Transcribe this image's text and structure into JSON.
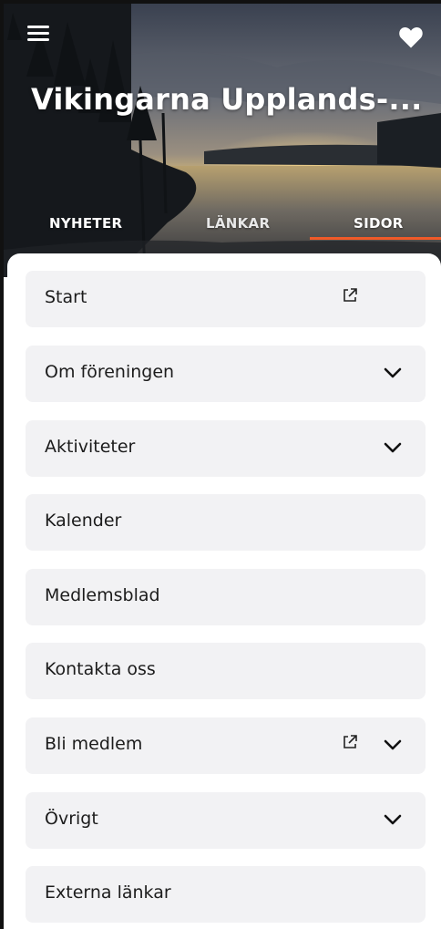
{
  "header": {
    "title": "Vikingarna Upplands-...",
    "menu_icon": "hamburger-menu-icon",
    "favorite_icon": "heart-icon"
  },
  "tabs": [
    {
      "label": "NYHETER",
      "active": false
    },
    {
      "label": "LÄNKAR",
      "active": false
    },
    {
      "label": "SIDOR",
      "active": true
    }
  ],
  "colors": {
    "accent": "#f05a28",
    "item_background": "#f2f2f4",
    "text": "#1c1c1c"
  },
  "pages": [
    {
      "label": "Start",
      "external": true,
      "expandable": false
    },
    {
      "label": "Om föreningen",
      "external": false,
      "expandable": true
    },
    {
      "label": "Aktiviteter",
      "external": false,
      "expandable": true
    },
    {
      "label": "Kalender",
      "external": false,
      "expandable": false
    },
    {
      "label": "Medlemsblad",
      "external": false,
      "expandable": false
    },
    {
      "label": "Kontakta oss",
      "external": false,
      "expandable": false
    },
    {
      "label": "Bli medlem",
      "external": true,
      "expandable": true
    },
    {
      "label": "Övrigt",
      "external": false,
      "expandable": true
    },
    {
      "label": "Externa länkar",
      "external": false,
      "expandable": false
    }
  ]
}
